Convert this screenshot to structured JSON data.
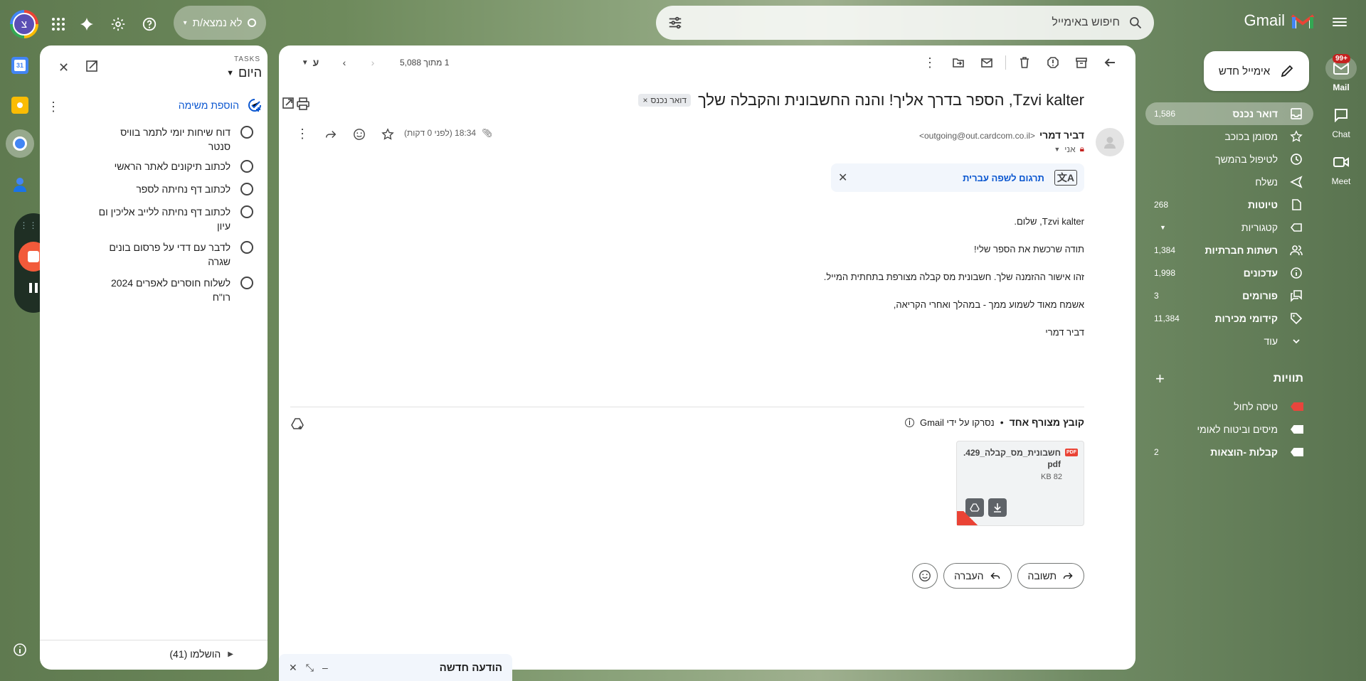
{
  "header": {
    "app_name": "Gmail",
    "search_placeholder": "חיפוש באימייל",
    "status": "לא נמצא/ת",
    "avatar_letter": "צ"
  },
  "rail": [
    {
      "label": "Mail",
      "badge": "99+",
      "icon": "mail-icon"
    },
    {
      "label": "Chat",
      "icon": "chat-icon"
    },
    {
      "label": "Meet",
      "icon": "video-icon"
    }
  ],
  "compose": {
    "label": "אימייל חדש"
  },
  "nav": [
    {
      "label": "דואר נכנס",
      "count": "1,586",
      "icon": "inbox-icon",
      "active": true
    },
    {
      "label": "מסומן בכוכב",
      "count": "",
      "icon": "star-icon"
    },
    {
      "label": "לטיפול בהמשך",
      "count": "",
      "icon": "clock-icon"
    },
    {
      "label": "נשלח",
      "count": "",
      "icon": "send-icon"
    },
    {
      "label": "טיוטות",
      "count": "268",
      "icon": "draft-icon",
      "bold": true
    },
    {
      "label": "קטגוריות",
      "count": "",
      "icon": "label-icon"
    },
    {
      "label": "רשתות חברתיות",
      "count": "1,384",
      "icon": "people-icon",
      "bold": true
    },
    {
      "label": "עדכונים",
      "count": "1,998",
      "icon": "info-icon",
      "bold": true
    },
    {
      "label": "פורומים",
      "count": "3",
      "icon": "forum-icon",
      "bold": true
    },
    {
      "label": "קידומי מכירות",
      "count": "11,384",
      "icon": "tag-icon",
      "bold": true
    },
    {
      "label": "עוד",
      "count": "",
      "icon": "chevron-down-icon"
    }
  ],
  "labels": {
    "title": "תוויות",
    "items": [
      {
        "name": "טיסה לחול",
        "color": "#e8453c",
        "count": ""
      },
      {
        "name": "מיסים וביטוח לאומי",
        "color": "#ffffff",
        "count": ""
      },
      {
        "name": "קבלות -הוצאות",
        "color": "#ffffff",
        "count": "2"
      }
    ]
  },
  "toolbar": {
    "pagination": "1 מתוך 5,088",
    "input_tool": "ע"
  },
  "email": {
    "subject": "Tzvi kalter, הספר בדרך אליך! והנה החשבונית והקבלה שלך",
    "label_chip": "דואר נכנס",
    "sender_name": "דביר דמרי",
    "sender_email": "<outgoing@out.cardcom.co.il>",
    "to": "אני",
    "time": "18:34 (לפני 0 דקות)",
    "translate": "תרגום לשפה עברית",
    "body": [
      "Tzvi kalter, שלום.",
      "תודה שרכשת את הספר שלי!",
      "זהו אישור ההזמנה שלך. חשבונית מס קבלה מצורפת בתחתית המייל.",
      "אשמח מאוד לשמוע ממך - במהלך ואחרי הקריאה,",
      "דביר דמרי"
    ],
    "attachments_title": "קובץ מצורף אחד",
    "scanned": "נסרקו על ידי Gmail",
    "attachment": {
      "name": "חשבונית_מס_קבלה_429.pdf",
      "size": "82 KB",
      "type": "PDF"
    },
    "reply": "תשובה",
    "forward": "העברה"
  },
  "tasks": {
    "brand": "TASKS",
    "list_name": "היום",
    "add": "הוספת משימה",
    "items": [
      "דוח שיחות יומי לתמר בוויס סנטר",
      "לכתוב תיקונים לאתר הראשי",
      "לכתוב דף נחיתה לספר",
      "לכתוב דף נחיתה ללייב אליכין ום עיון",
      "לדבר עם דדי על פרסום בונים שגרה",
      "לשלוח חוסרים לאפרים 2024 רו\"ח"
    ],
    "completed": "הושלמו (41)"
  },
  "mini_compose": {
    "title": "הודעה חדשה"
  }
}
